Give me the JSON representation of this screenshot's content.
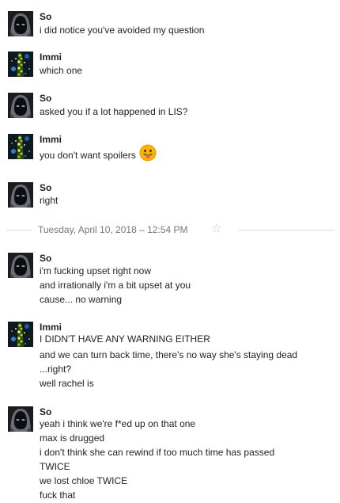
{
  "divider": {
    "timestamp": "Tuesday, April 10, 2018  – 12:54 PM",
    "star_icon": "star-outline-icon"
  },
  "messages": [
    {
      "sender": "So",
      "avatar": "hooded-figure",
      "lines": [
        "i did notice you've avoided my question"
      ]
    },
    {
      "sender": "Immi",
      "avatar": "green-glitter",
      "lines": [
        "which one"
      ]
    },
    {
      "sender": "So",
      "avatar": "hooded-figure",
      "lines": [
        "asked you if a lot happened in LIS?"
      ]
    },
    {
      "sender": "Immi",
      "avatar": "green-glitter",
      "lines": [
        "you don't want spoilers"
      ],
      "emoji": "tongue-out-smiley"
    },
    {
      "sender": "So",
      "avatar": "hooded-figure",
      "lines": [
        "right"
      ]
    },
    {
      "sender": "So",
      "avatar": "hooded-figure",
      "lines": [
        "i'm fucking upset right now",
        "and irrationally i'm a bit upset at you",
        "cause... no warning"
      ]
    },
    {
      "sender": "Immi",
      "avatar": "green-glitter",
      "lines": [
        "I DIDN'T HAVE ANY WARNING EITHER",
        "and we can turn back time, there's no way she's staying dead",
        "...right?",
        "well rachel is"
      ]
    },
    {
      "sender": "So",
      "avatar": "hooded-figure",
      "lines": [
        "yeah i think we're f*ed up on that one",
        "max is drugged",
        "i don't think she can rewind if too much time has passed",
        "TWICE",
        "we lost chloe TWICE",
        "fuck that"
      ]
    }
  ]
}
